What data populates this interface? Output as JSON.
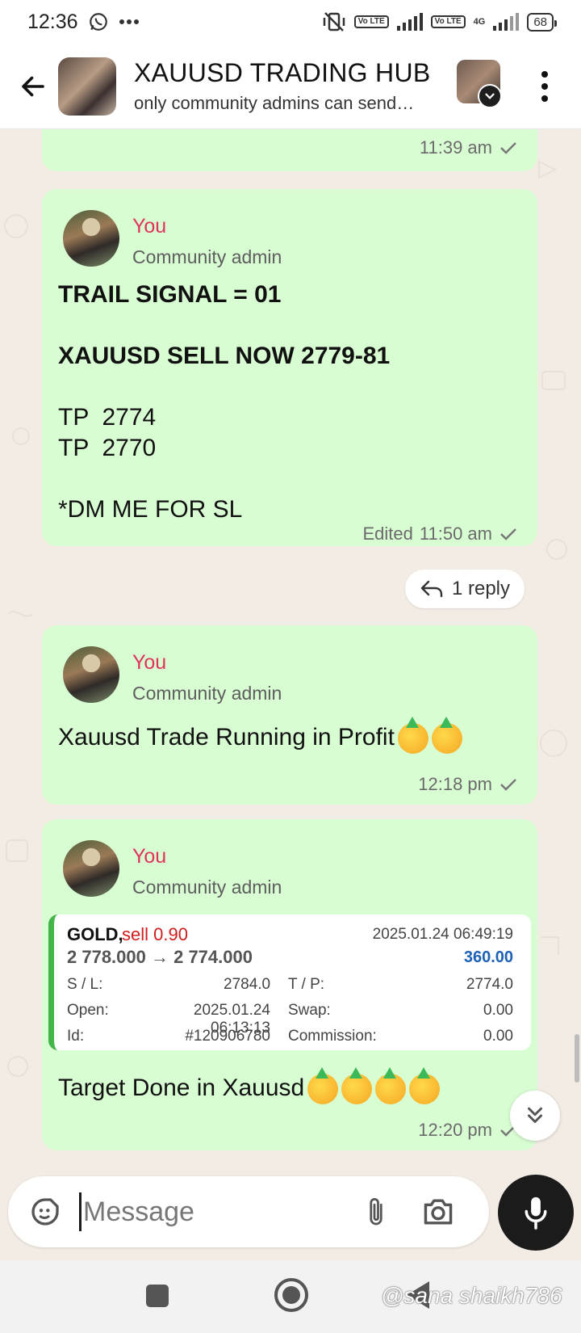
{
  "status_bar": {
    "time": "12:36",
    "lte1": "Vo LTE",
    "lte2": "Vo LTE",
    "net": "4G",
    "battery": "68"
  },
  "header": {
    "title": "XAUUSD TRADING HUB",
    "subtitle": "only community admins can send…"
  },
  "messages": [
    {
      "time": "11:39 am"
    },
    {
      "sender": "You",
      "role": "Community admin",
      "lines": [
        "TRAIL SIGNAL = 01",
        "XAUUSD SELL NOW 2779-81",
        "TP  2774",
        "TP  2770",
        "*DM ME FOR SL"
      ],
      "edited": "Edited",
      "time": "11:50 am",
      "replies": "1 reply"
    },
    {
      "sender": "You",
      "role": "Community admin",
      "text": "Xauusd Trade Running in Profit",
      "time": "12:18 pm"
    },
    {
      "sender": "You",
      "role": "Community admin",
      "trade": {
        "symbol": "GOLD,",
        "side": "sell 0.90",
        "datetime": "2025.01.24 06:49:19",
        "prices": "2 778.000 → 2 774.000",
        "profit": "360.00",
        "sl_label": "S / L:",
        "sl": "2784.0",
        "tp_label": "T / P:",
        "tp": "2774.0",
        "open_label": "Open:",
        "open": "2025.01.24 06:13:13",
        "swap_label": "Swap:",
        "swap": "0.00",
        "id_label": "Id:",
        "id": "#120906780",
        "commission_label": "Commission:",
        "commission": "0.00"
      },
      "text": "Target Done in Xauusd",
      "time": "12:20 pm"
    }
  ],
  "composer": {
    "placeholder": "Message"
  },
  "watermark": "@sana shaikh786",
  "icons": {
    "back": "arrow-left-icon",
    "menu": "more-vert-icon",
    "sticker": "sticker-icon",
    "attach": "paperclip-icon",
    "camera": "camera-icon",
    "mic": "microphone-icon",
    "scroll": "double-chevron-down-icon",
    "reply": "reply-arrow-icon",
    "party_emoji": "partying-face-emoji-icon"
  },
  "colors": {
    "bubble": "#d9fdd3",
    "sender_name": "#e0335b",
    "profit": "#1e62b8",
    "sell": "#d11d1d",
    "card_accent": "#43b649"
  }
}
